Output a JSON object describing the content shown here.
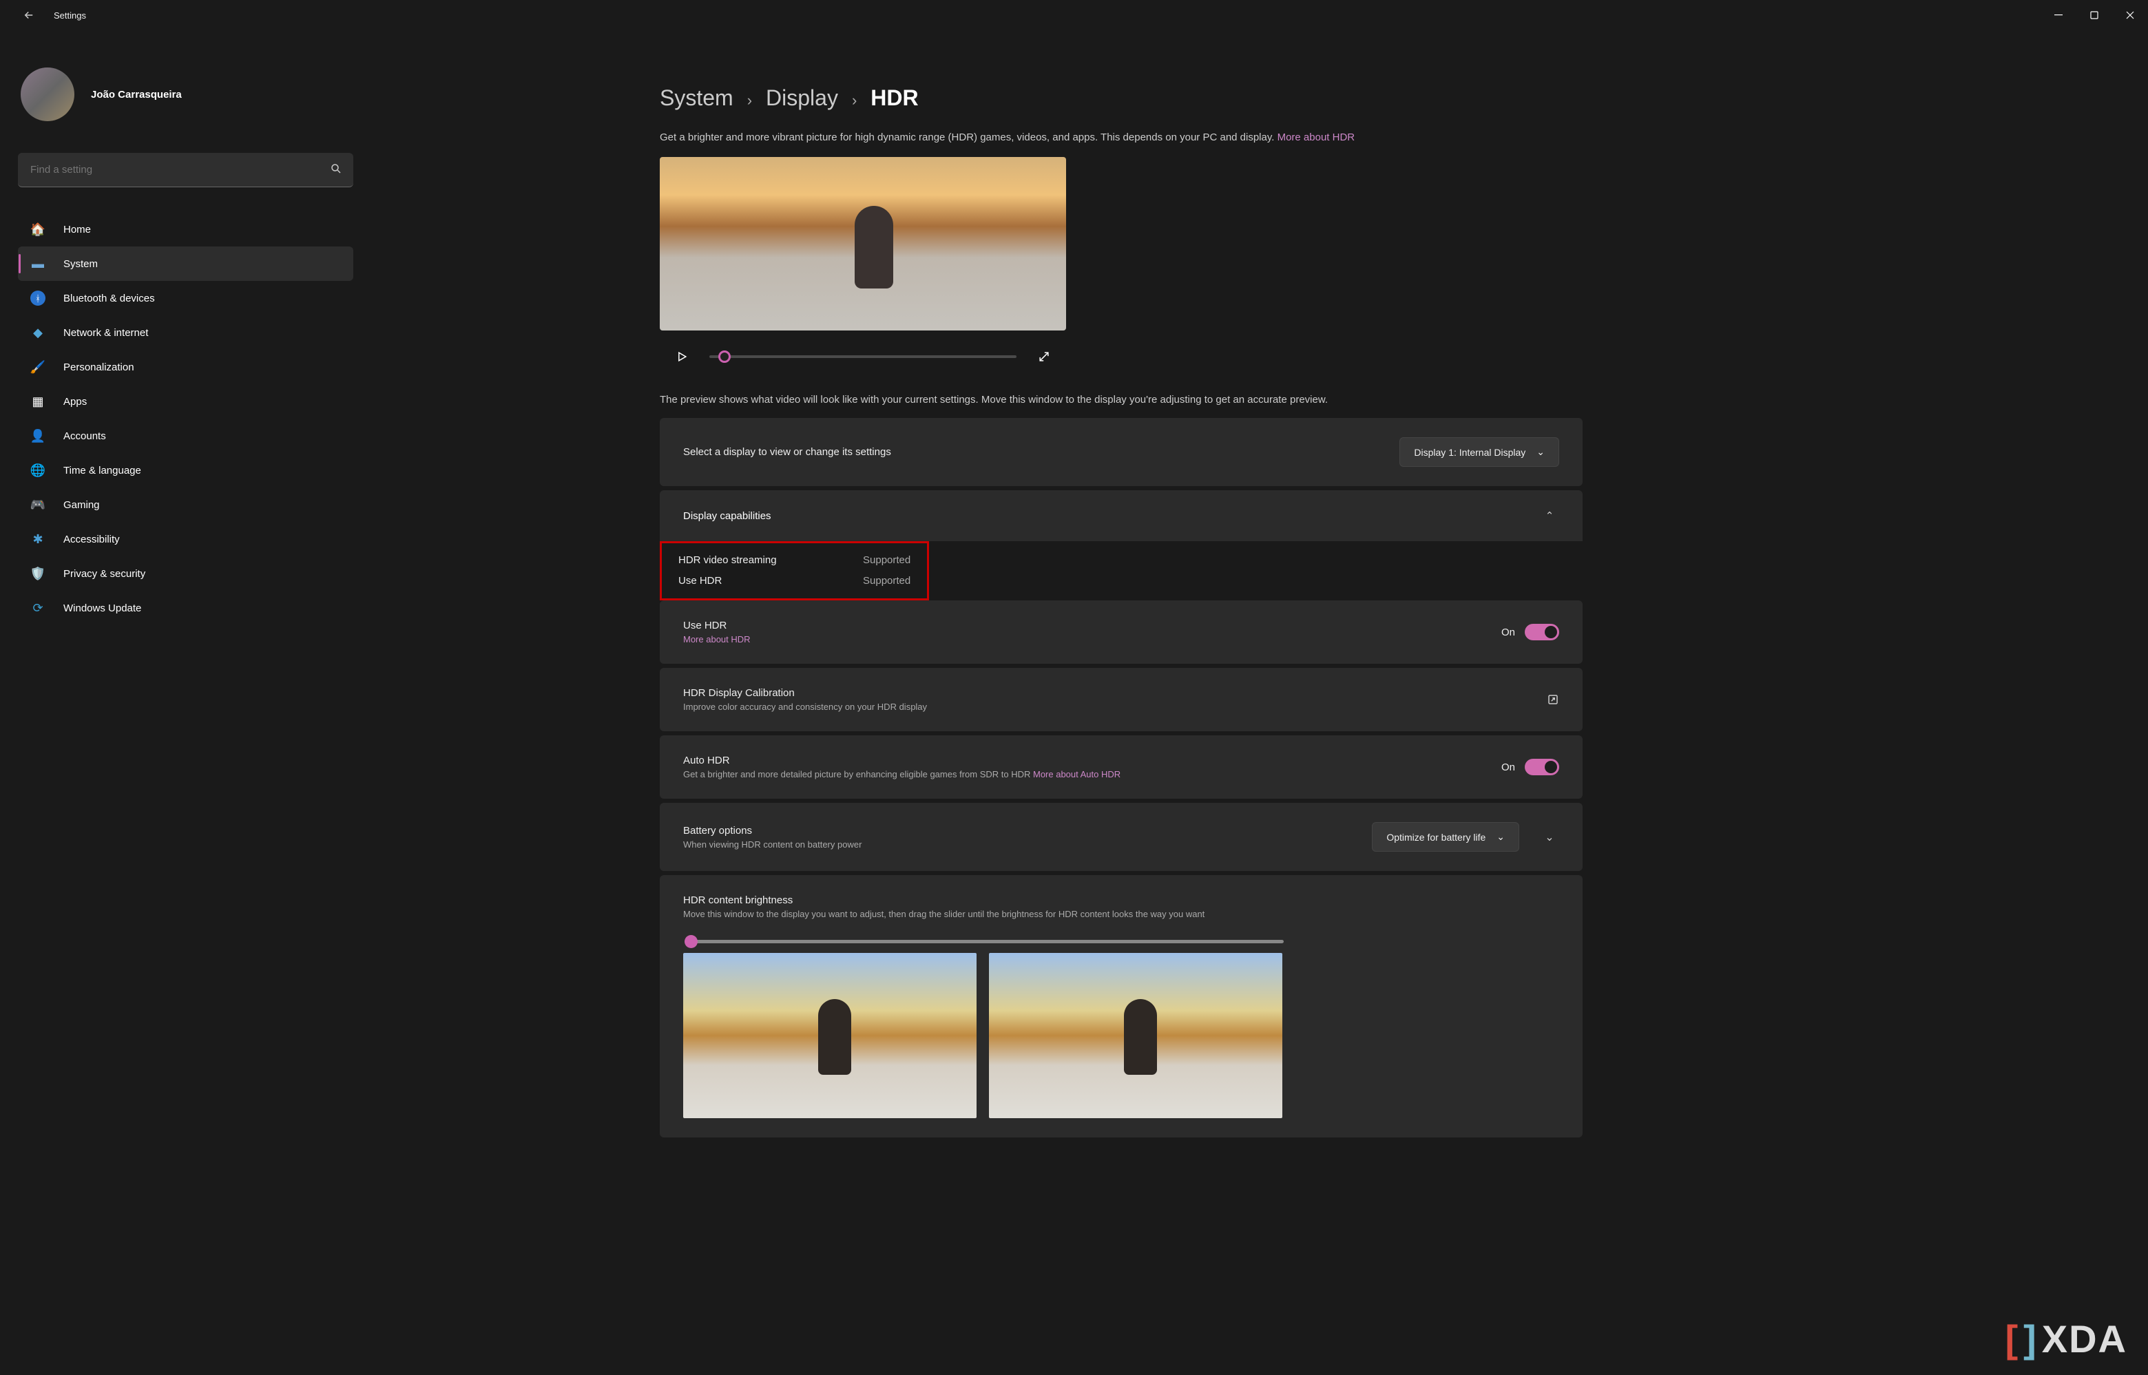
{
  "window": {
    "title": "Settings"
  },
  "user": {
    "name": "João Carrasqueira"
  },
  "search": {
    "placeholder": "Find a setting"
  },
  "sidebar": {
    "items": [
      {
        "label": "Home"
      },
      {
        "label": "System"
      },
      {
        "label": "Bluetooth & devices"
      },
      {
        "label": "Network & internet"
      },
      {
        "label": "Personalization"
      },
      {
        "label": "Apps"
      },
      {
        "label": "Accounts"
      },
      {
        "label": "Time & language"
      },
      {
        "label": "Gaming"
      },
      {
        "label": "Accessibility"
      },
      {
        "label": "Privacy & security"
      },
      {
        "label": "Windows Update"
      }
    ]
  },
  "breadcrumb": {
    "first": "System",
    "second": "Display",
    "current": "HDR"
  },
  "description": "Get a brighter and more vibrant picture for high dynamic range (HDR) games, videos, and apps. This depends on your PC and display. ",
  "more_about_hdr": "More about HDR",
  "preview_hint": "The preview shows what video will look like with your current settings. Move this window to the display you're adjusting to get an accurate preview.",
  "display_select": {
    "label": "Select a display to view or change its settings",
    "value": "Display 1: Internal Display"
  },
  "capabilities": {
    "header": "Display capabilities",
    "rows": [
      {
        "label": "HDR video streaming",
        "value": "Supported"
      },
      {
        "label": "Use HDR",
        "value": "Supported"
      }
    ]
  },
  "use_hdr": {
    "title": "Use HDR",
    "link": "More about HDR",
    "state": "On"
  },
  "calibration": {
    "title": "HDR Display Calibration",
    "sub": "Improve color accuracy and consistency on your HDR display"
  },
  "auto_hdr": {
    "title": "Auto HDR",
    "sub": "Get a brighter and more detailed picture by enhancing eligible games from SDR to HDR ",
    "link": "More about Auto HDR",
    "state": "On"
  },
  "battery": {
    "title": "Battery options",
    "sub": "When viewing HDR content on battery power",
    "value": "Optimize for battery life"
  },
  "brightness": {
    "title": "HDR content brightness",
    "sub": "Move this window to the display you want to adjust, then drag the slider until the brightness for HDR content looks the way you want"
  },
  "watermark": "XDA"
}
